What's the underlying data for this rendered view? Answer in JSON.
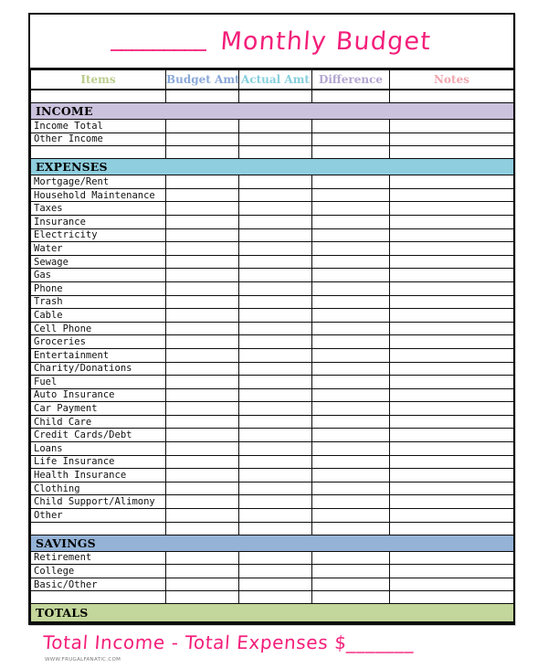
{
  "document": {
    "title_blank": "_________",
    "title": "Monthly Budget",
    "watermark": "WWW.FRUGALFANATIC.COM"
  },
  "colors": {
    "pink": "#f31e7a",
    "income_banner": "#cbc2dd",
    "expenses_banner": "#8ecede",
    "savings_banner": "#95b3d7",
    "totals_banner": "#c3d69b",
    "header_items": "#b9cc8c",
    "header_budget": "#8aa8d8",
    "header_actual": "#86cfdd",
    "header_difference": "#b3a5d0",
    "header_notes": "#f0a6ae"
  },
  "table": {
    "columns": [
      {
        "key": "items",
        "label": "Items"
      },
      {
        "key": "budget",
        "label": "Budget Amt"
      },
      {
        "key": "actual",
        "label": "Actual Amt"
      },
      {
        "key": "difference",
        "label": "Difference"
      },
      {
        "key": "notes",
        "label": "Notes"
      }
    ],
    "sections": [
      {
        "key": "income",
        "label": "INCOME",
        "rows": [
          "Income Total",
          "Other Income"
        ]
      },
      {
        "key": "expenses",
        "label": "EXPENSES",
        "rows": [
          "Mortgage/Rent",
          "Household Maintenance",
          "Taxes",
          "Insurance",
          "Electricity",
          "Water",
          "Sewage",
          "Gas",
          "Phone",
          "Trash",
          "Cable",
          "Cell Phone",
          "Groceries",
          "Entertainment",
          "Charity/Donations",
          "Fuel",
          "Auto Insurance",
          "Car Payment",
          "Child Care",
          "Credit Cards/Debt",
          "Loans",
          "Life Insurance",
          "Health Insurance",
          "Clothing",
          "Child Support/Alimony",
          "Other"
        ]
      },
      {
        "key": "savings",
        "label": "SAVINGS",
        "rows": [
          "Retirement",
          "College",
          "Basic/Other"
        ]
      },
      {
        "key": "totals",
        "label": "TOTALS",
        "rows": []
      }
    ]
  },
  "footer": {
    "summary": "Total Income - Total Expenses $_______"
  }
}
